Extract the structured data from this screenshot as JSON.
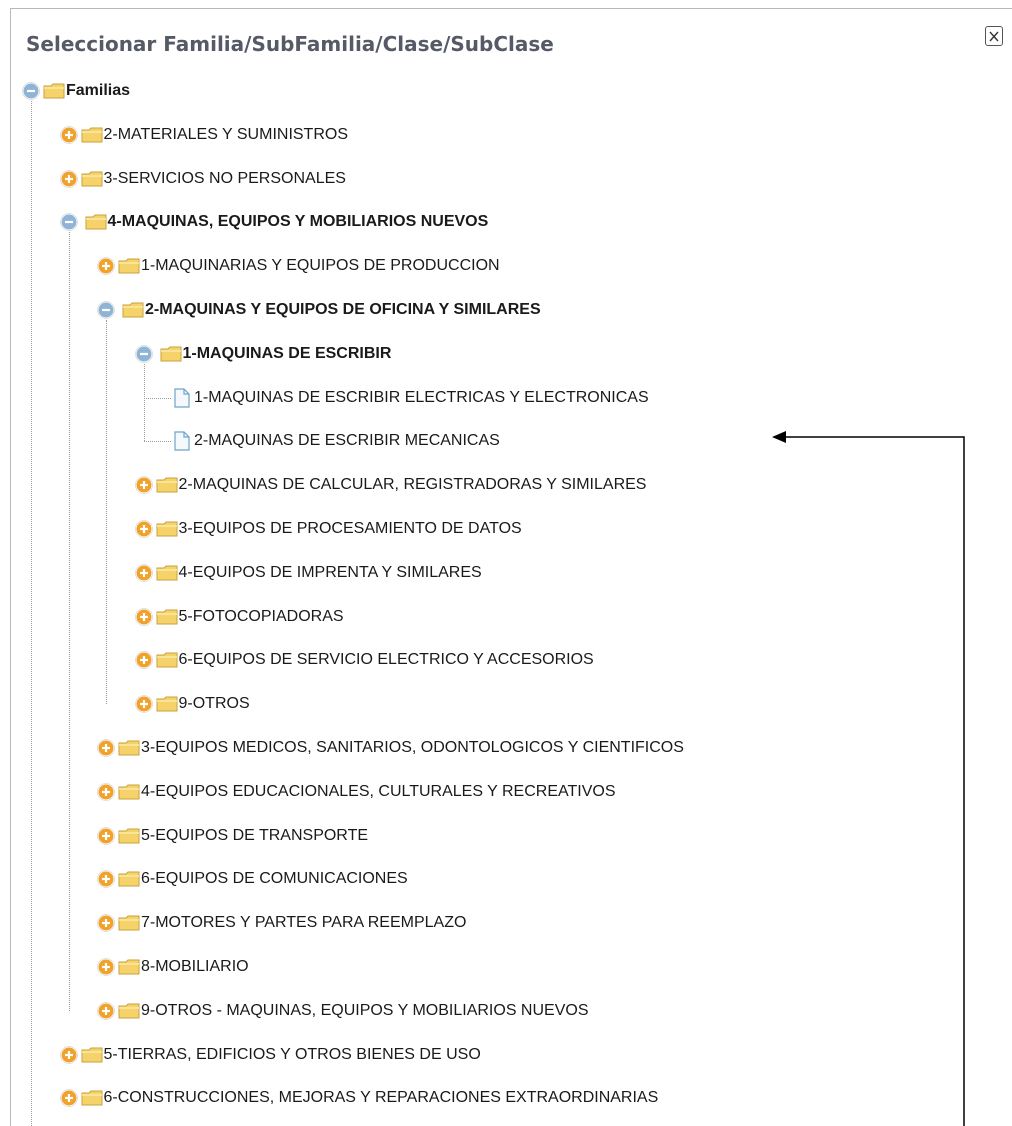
{
  "dialog": {
    "title": "Seleccionar Familia/SubFamilia/Clase/SubClase",
    "close_symbol": "X"
  },
  "tree": [
    {
      "label": "Familias",
      "level": 0,
      "type": "folder",
      "expanded": true
    },
    {
      "label": "2-MATERIALES Y SUMINISTROS",
      "level": 1,
      "type": "folder",
      "expanded": false
    },
    {
      "label": "3-SERVICIOS NO PERSONALES",
      "level": 1,
      "type": "folder",
      "expanded": false
    },
    {
      "label": "4-MAQUINAS, EQUIPOS Y MOBILIARIOS NUEVOS",
      "level": 1,
      "type": "folder",
      "expanded": true
    },
    {
      "label": "1-MAQUINARIAS Y EQUIPOS DE PRODUCCION",
      "level": 2,
      "type": "folder",
      "expanded": false
    },
    {
      "label": "2-MAQUINAS Y EQUIPOS DE OFICINA Y SIMILARES",
      "level": 2,
      "type": "folder",
      "expanded": true
    },
    {
      "label": "1-MAQUINAS DE ESCRIBIR",
      "level": 3,
      "type": "folder",
      "expanded": true
    },
    {
      "label": "1-MAQUINAS DE ESCRIBIR ELECTRICAS Y ELECTRONICAS",
      "level": 4,
      "type": "file"
    },
    {
      "label": "2-MAQUINAS DE ESCRIBIR MECANICAS",
      "level": 4,
      "type": "file"
    },
    {
      "label": "2-MAQUINAS DE CALCULAR, REGISTRADORAS Y SIMILARES",
      "level": 3,
      "type": "folder",
      "expanded": false
    },
    {
      "label": "3-EQUIPOS DE PROCESAMIENTO DE DATOS",
      "level": 3,
      "type": "folder",
      "expanded": false
    },
    {
      "label": "4-EQUIPOS DE IMPRENTA Y SIMILARES",
      "level": 3,
      "type": "folder",
      "expanded": false
    },
    {
      "label": "5-FOTOCOPIADORAS",
      "level": 3,
      "type": "folder",
      "expanded": false
    },
    {
      "label": "6-EQUIPOS DE SERVICIO ELECTRICO Y ACCESORIOS",
      "level": 3,
      "type": "folder",
      "expanded": false
    },
    {
      "label": "9-OTROS",
      "level": 3,
      "type": "folder",
      "expanded": false
    },
    {
      "label": "3-EQUIPOS MEDICOS, SANITARIOS, ODONTOLOGICOS Y CIENTIFICOS",
      "level": 2,
      "type": "folder",
      "expanded": false
    },
    {
      "label": "4-EQUIPOS EDUCACIONALES, CULTURALES Y RECREATIVOS",
      "level": 2,
      "type": "folder",
      "expanded": false
    },
    {
      "label": "5-EQUIPOS DE TRANSPORTE",
      "level": 2,
      "type": "folder",
      "expanded": false
    },
    {
      "label": "6-EQUIPOS DE COMUNICACIONES",
      "level": 2,
      "type": "folder",
      "expanded": false
    },
    {
      "label": "7-MOTORES Y PARTES PARA REEMPLAZO",
      "level": 2,
      "type": "folder",
      "expanded": false
    },
    {
      "label": "8-MOBILIARIO",
      "level": 2,
      "type": "folder",
      "expanded": false
    },
    {
      "label": "9-OTROS - MAQUINAS, EQUIPOS Y MOBILIARIOS NUEVOS",
      "level": 2,
      "type": "folder",
      "expanded": false
    },
    {
      "label": "5-TIERRAS, EDIFICIOS Y OTROS BIENES DE USO",
      "level": 1,
      "type": "folder",
      "expanded": false
    },
    {
      "label": "6-CONSTRUCCIONES, MEJORAS Y REPARACIONES EXTRAORDINARIAS",
      "level": 1,
      "type": "folder",
      "expanded": false
    }
  ],
  "icons": {
    "collapse": "minus-circle-icon",
    "expand": "plus-circle-icon",
    "folder": "folder-icon",
    "file": "file-icon"
  },
  "colors": {
    "title": "#555a66",
    "expand_toggle": "#f0a22a",
    "collapse_toggle": "#8fb4d6",
    "folder": "#f6d36a",
    "file": "#6fa3c8"
  }
}
